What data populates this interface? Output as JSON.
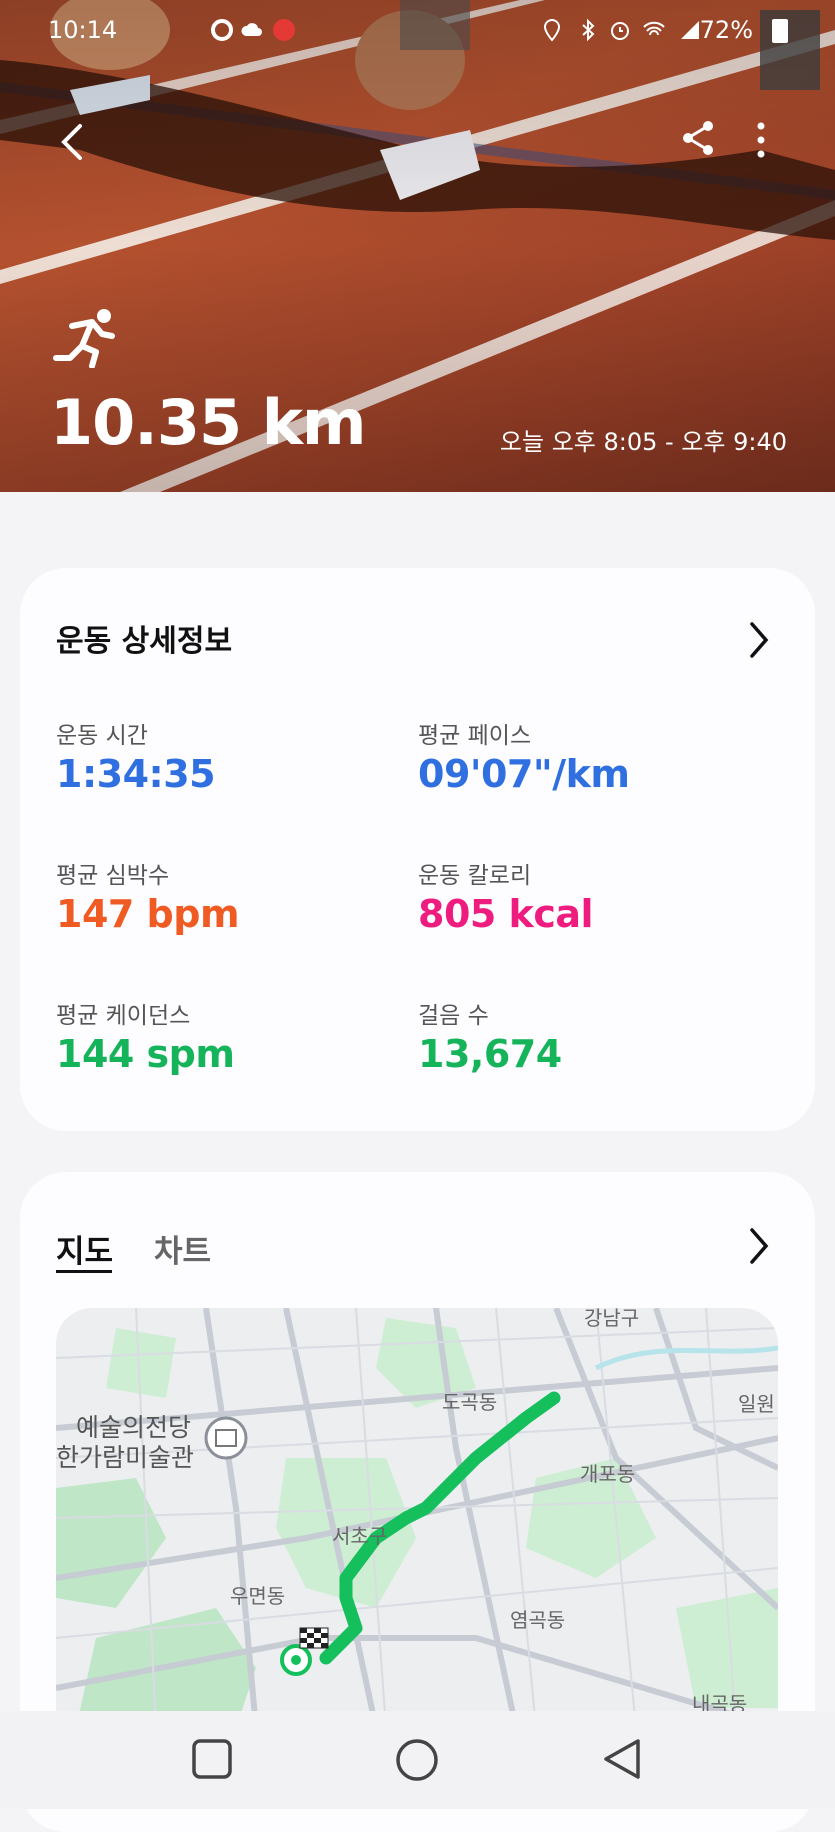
{
  "status_bar": {
    "time": "10:14",
    "battery": "72%"
  },
  "hero": {
    "distance": "10.35 km",
    "time_range": "오늘 오후 8:05 - 오후 9:40"
  },
  "details_card": {
    "title": "운동 상세정보",
    "metrics": [
      {
        "label": "운동 시간",
        "value": "1:34:35",
        "color": "#2f6fe0"
      },
      {
        "label": "평균 페이스",
        "value": "09'07\"/km",
        "color": "#2f6fe0"
      },
      {
        "label": "평균 심박수",
        "value": "147 bpm",
        "color": "#f05a23"
      },
      {
        "label": "운동 칼로리",
        "value": "805 kcal",
        "color": "#ee1c7e"
      },
      {
        "label": "평균 케이던스",
        "value": "144 spm",
        "color": "#15b45a"
      },
      {
        "label": "걸음 수",
        "value": "13,674",
        "color": "#15b45a"
      }
    ]
  },
  "map_card": {
    "tabs": [
      {
        "label": "지도",
        "active": true
      },
      {
        "label": "차트",
        "active": false
      }
    ],
    "map_labels": {
      "arts_center_1": "예술의전당",
      "arts_center_2": "한가람미술관",
      "dogok": "도곡동",
      "gaepo": "개포동",
      "seocho": "서초구",
      "umyeon": "우면동",
      "yeomgok": "염곡동",
      "naegok": "내곡동",
      "gangnam": "강남구",
      "irwon": "일원"
    },
    "route_color": "#15c05c"
  },
  "nav_bar": {
    "icons": [
      "recent-apps-icon",
      "home-icon",
      "back-icon"
    ]
  }
}
